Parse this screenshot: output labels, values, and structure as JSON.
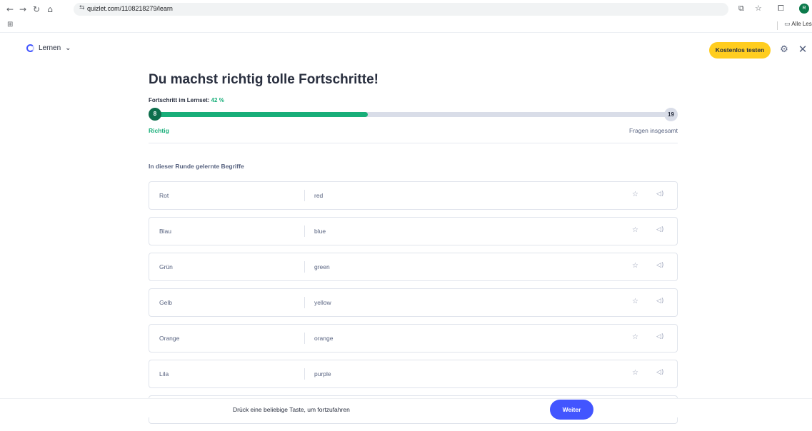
{
  "browser": {
    "url": "quizlet.com/1108218279/learn",
    "bookmark_folder": "Alle Lesezeichen",
    "profile_initial": "R",
    "icons": [
      "back-icon",
      "forward-icon",
      "reload-icon",
      "home-icon",
      "site-info-icon",
      "cast-icon",
      "star-icon",
      "extensions-icon",
      "apps-icon",
      "folder-icon"
    ]
  },
  "header": {
    "mode_label": "Lernen",
    "trial_button": "Kostenlos testen"
  },
  "main": {
    "title": "Du machst richtig tolle Fortschritte!",
    "progress_label": "Fortschritt im Lernset:",
    "progress_percent_text": "42 %",
    "progress_fraction": 0.42,
    "correct_count": "8",
    "total_count": "19",
    "correct_label": "Richtig",
    "total_label": "Fragen insgesamt",
    "section_heading": "In dieser Runde gelernte Begriffe",
    "terms": [
      {
        "term": "Rot",
        "definition": "red"
      },
      {
        "term": "Blau",
        "definition": "blue"
      },
      {
        "term": "Grün",
        "definition": "green"
      },
      {
        "term": "Gelb",
        "definition": "yellow"
      },
      {
        "term": "Orange",
        "definition": "orange"
      },
      {
        "term": "Lila",
        "definition": "purple"
      }
    ]
  },
  "footer": {
    "hint": "Drück eine beliebige Taste, um fortzufahren",
    "continue_button": "Weiter"
  },
  "colors": {
    "accent": "#4255ff",
    "success": "#18ae79",
    "trial": "#ffcd1f"
  }
}
